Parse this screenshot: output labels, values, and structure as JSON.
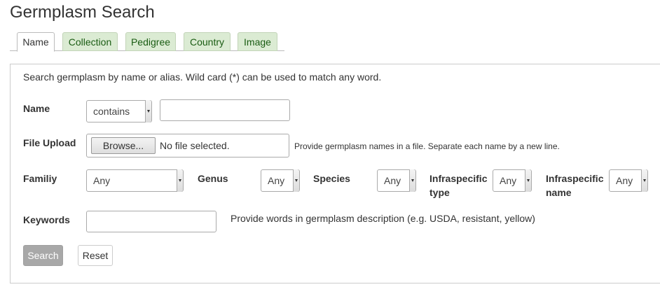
{
  "page": {
    "title": "Germplasm Search"
  },
  "tabs": [
    {
      "label": "Name",
      "active": true
    },
    {
      "label": "Collection",
      "active": false
    },
    {
      "label": "Pedigree",
      "active": false
    },
    {
      "label": "Country",
      "active": false
    },
    {
      "label": "Image",
      "active": false
    }
  ],
  "form": {
    "description": "Search germplasm by name or alias. Wild card (*) can be used to match any word.",
    "name": {
      "label": "Name",
      "operator": "contains",
      "value": ""
    },
    "file_upload": {
      "label": "File Upload",
      "browse_label": "Browse...",
      "status": "No file selected.",
      "help": "Provide germplasm names in a file. Separate each name by a new line."
    },
    "family": {
      "label": "Familiy",
      "value": "Any"
    },
    "genus": {
      "label": "Genus",
      "value": "Any"
    },
    "species": {
      "label": "Species",
      "value": "Any"
    },
    "infraspecific_type": {
      "label_line1": "Infraspecific",
      "label_line2": "type",
      "value": "Any"
    },
    "infraspecific_name": {
      "label_line1": "Infraspecific",
      "label_line2": "name",
      "value": "Any"
    },
    "keywords": {
      "label": "Keywords",
      "value": "",
      "help": "Provide words in germplasm description (e.g. USDA, resistant, yellow)"
    },
    "search_label": "Search",
    "reset_label": "Reset"
  },
  "colors": {
    "tab_inactive_bg": "#dbebd3",
    "tab_inactive_text": "#1a5c13",
    "search_button_bg": "#a8a8a8"
  }
}
